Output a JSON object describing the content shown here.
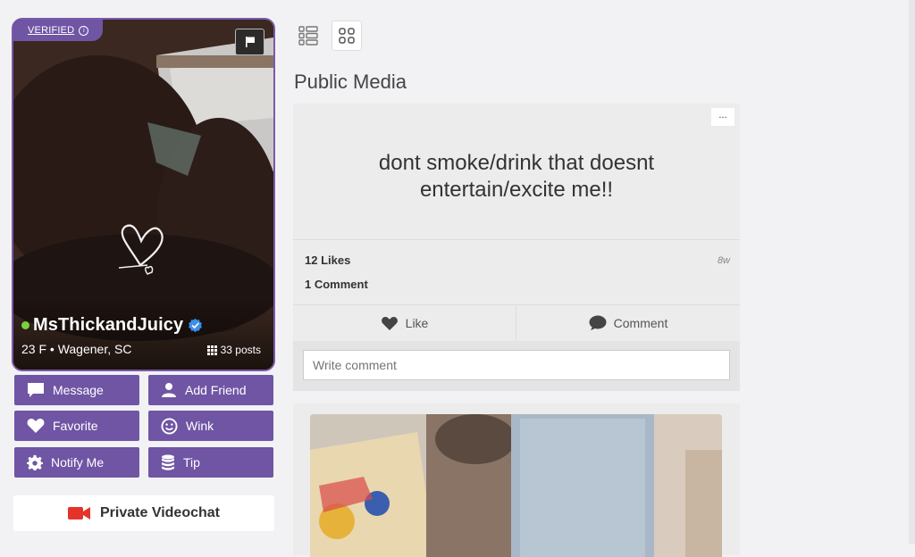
{
  "profile": {
    "verified_label": "VERIFIED",
    "info_icon": "i",
    "username": "MsThickandJuicy",
    "meta": "23 F • Wagener, SC",
    "posts": "33 posts",
    "online_color": "#7cd13b",
    "accent_color": "#6f55a4"
  },
  "actions": {
    "message": "Message",
    "add_friend": "Add Friend",
    "favorite": "Favorite",
    "wink": "Wink",
    "notify_me": "Notify Me",
    "tip": "Tip",
    "private_videochat": "Private Videochat"
  },
  "main": {
    "section_title": "Public Media",
    "post": {
      "more": "...",
      "text_line1": "dont smoke/drink that doesnt",
      "text_line2": "entertain/excite me!!",
      "likes": "12 Likes",
      "comments": "1 Comment",
      "age": "8w",
      "like_label": "Like",
      "comment_label": "Comment",
      "comment_placeholder": "Write comment"
    }
  }
}
